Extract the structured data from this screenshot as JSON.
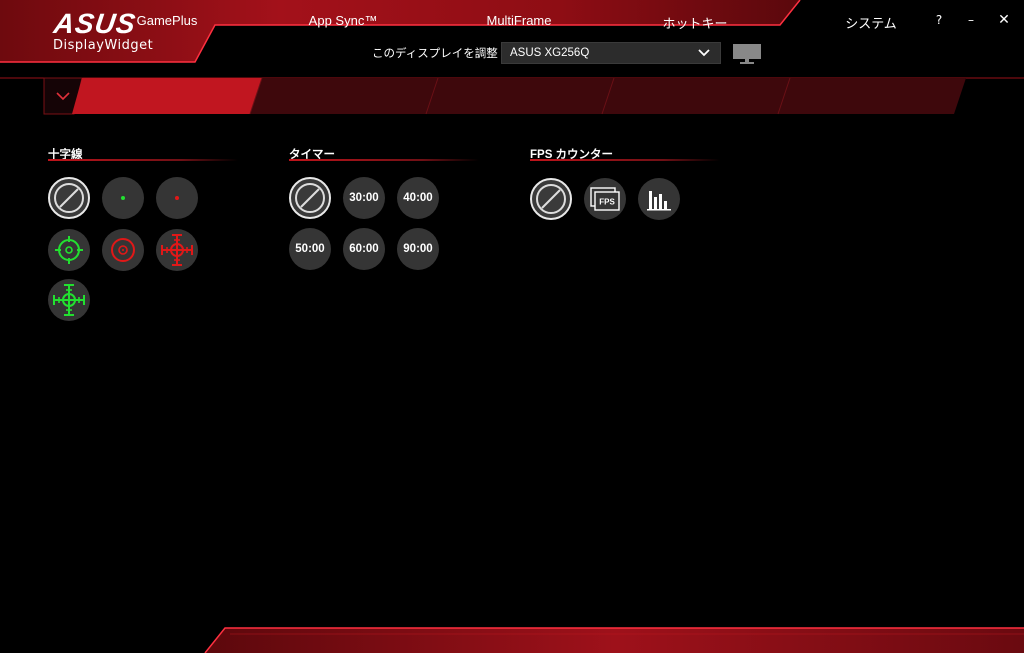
{
  "app": {
    "brand": "ASUS",
    "name": "DisplayWidget"
  },
  "window_controls": {
    "help": "?",
    "minimize": "–",
    "close": "✕"
  },
  "display": {
    "label": "このディスプレイを調整",
    "selected": "ASUS XG256Q"
  },
  "tabs": [
    {
      "label": "GamePlus",
      "active": true
    },
    {
      "label": "App Sync™",
      "active": false
    },
    {
      "label": "MultiFrame",
      "active": false
    },
    {
      "label": "ホットキー",
      "active": false
    },
    {
      "label": "システム",
      "active": false
    }
  ],
  "sections": {
    "crosshair": {
      "title": "十字線",
      "options": [
        "none-icon",
        "green-dot-icon",
        "red-dot-icon",
        "green-circle-crosshair-icon",
        "red-circle-crosshair-icon",
        "red-cross-crosshair-icon",
        "green-cross-crosshair-icon"
      ]
    },
    "timer": {
      "title": "タイマー",
      "options": [
        "none-icon",
        "30:00",
        "40:00",
        "50:00",
        "60:00",
        "90:00"
      ]
    },
    "fps": {
      "title": "FPS カウンター",
      "options": [
        "none-icon",
        "FPS",
        "bar-graph-icon"
      ]
    }
  },
  "colors": {
    "accent_red": "#c0141b",
    "crosshair_green": "#22e030",
    "crosshair_red": "#e01818",
    "button_bg": "#353535"
  }
}
